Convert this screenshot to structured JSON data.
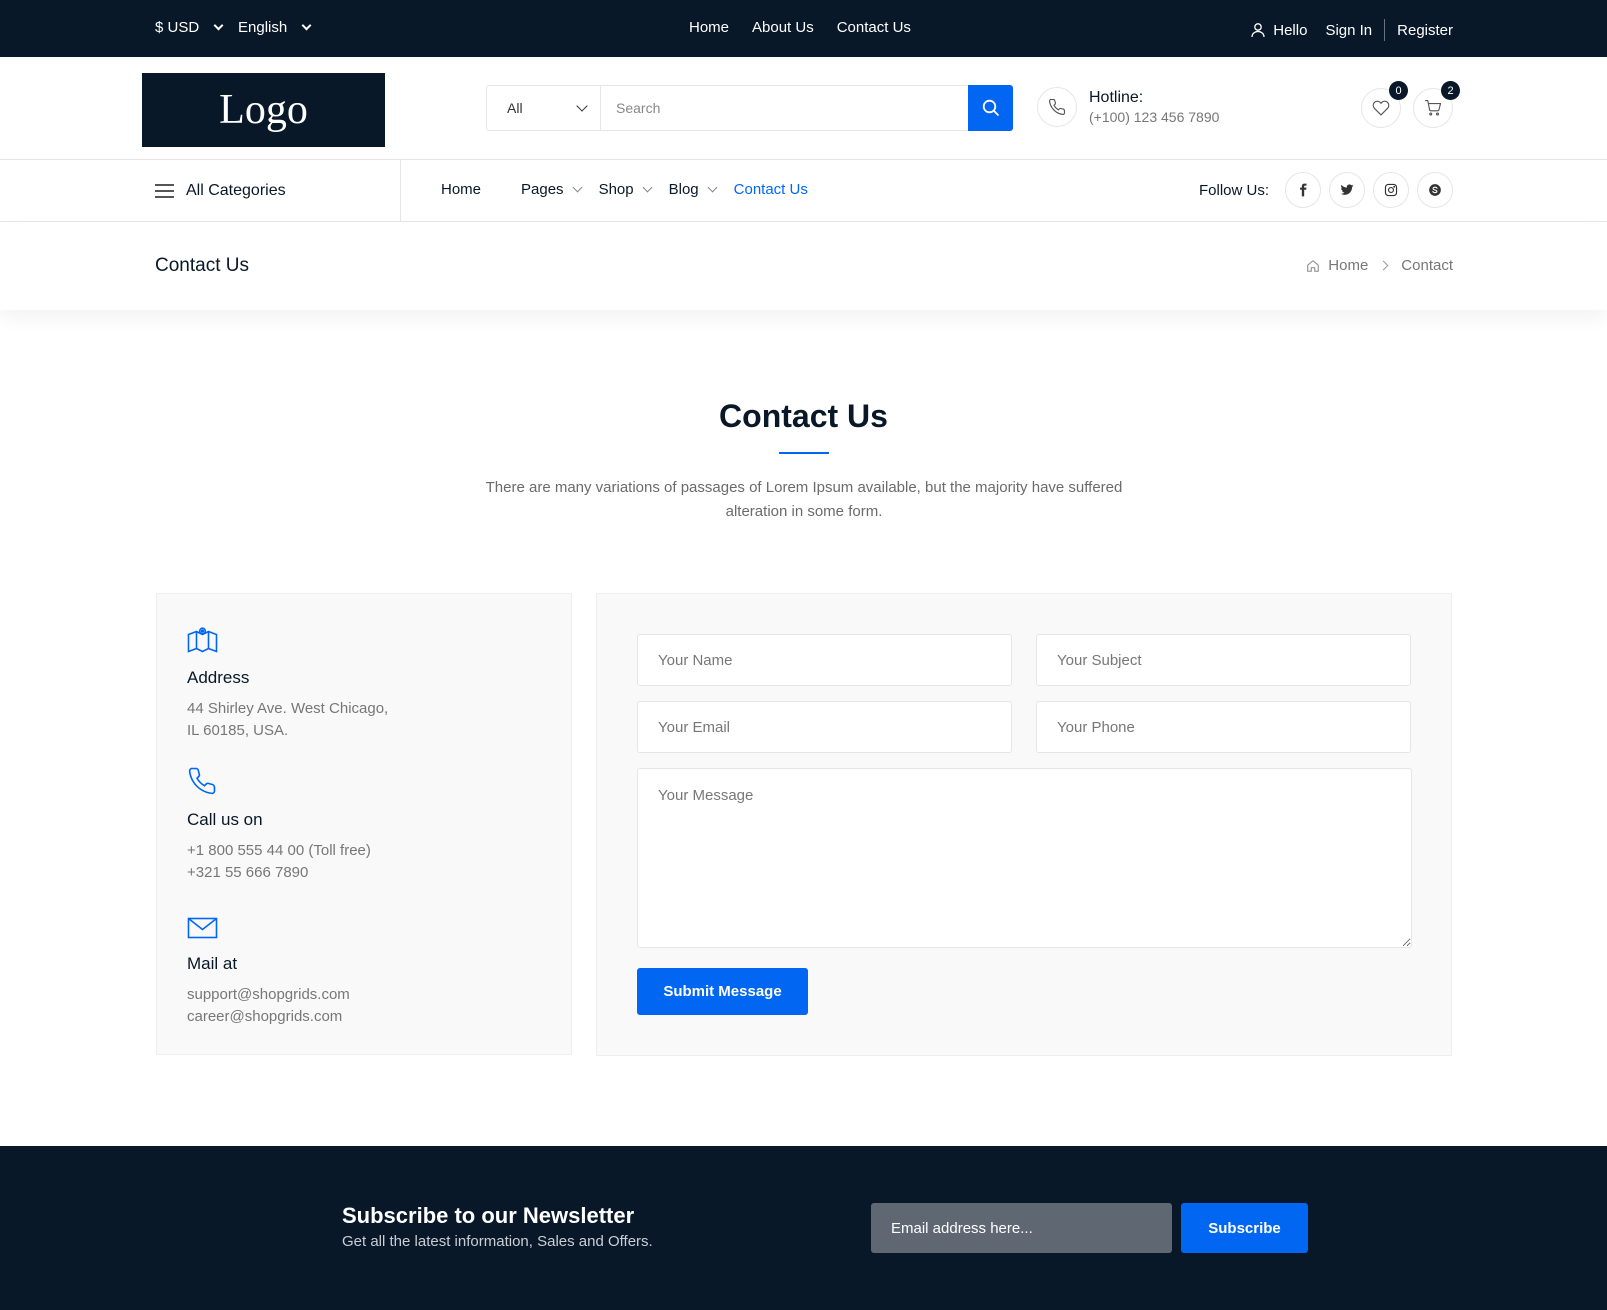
{
  "topbar": {
    "currency": "$ USD",
    "language": "English",
    "nav": [
      "Home",
      "About Us",
      "Contact Us"
    ],
    "hello": "Hello",
    "sign_in": "Sign In",
    "register": "Register"
  },
  "header": {
    "logo": "Logo",
    "search": {
      "category": "All",
      "placeholder": "Search"
    },
    "hotline": {
      "label": "Hotline:",
      "number": "(+100) 123 456 7890"
    },
    "wishlist_count": "0",
    "cart_count": "2"
  },
  "navbar": {
    "all_categories": "All Categories",
    "items": [
      {
        "label": "Home"
      },
      {
        "label": "Pages"
      },
      {
        "label": "Shop"
      },
      {
        "label": "Blog"
      },
      {
        "label": "Contact Us"
      }
    ],
    "follow_label": "Follow Us:"
  },
  "breadcrumb": {
    "page_title": "Contact Us",
    "home": "Home",
    "current": "Contact"
  },
  "section": {
    "title": "Contact Us",
    "description": "There are many variations of passages of Lorem Ipsum available, but the majority have suffered alteration in some form."
  },
  "info": {
    "address": {
      "title": "Address",
      "line1": "44 Shirley Ave. West Chicago,",
      "line2": "IL 60185, USA."
    },
    "call": {
      "title": "Call us on",
      "line1": "+1 800 555 44 00 (Toll free)",
      "line2": "+321 55 666 7890"
    },
    "mail": {
      "title": "Mail at",
      "line1": "support@shopgrids.com",
      "line2": "career@shopgrids.com"
    }
  },
  "form": {
    "name_placeholder": "Your Name",
    "subject_placeholder": "Your Subject",
    "email_placeholder": "Your Email",
    "phone_placeholder": "Your Phone",
    "message_placeholder": "Your Message",
    "submit": "Submit Message"
  },
  "newsletter": {
    "title": "Subscribe to our Newsletter",
    "subtitle": "Get all the latest information, Sales and Offers.",
    "email_placeholder": "Email address here...",
    "button": "Subscribe"
  },
  "colors": {
    "accent": "#0167f3",
    "dark": "#081828"
  }
}
